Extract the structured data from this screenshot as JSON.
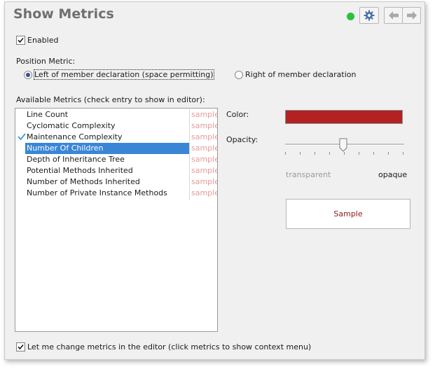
{
  "header": {
    "title": "Show Metrics",
    "status_color": "#2bc13a",
    "buttons": [
      {
        "icon": "gear-icon"
      },
      {
        "icon": "arrow-left-icon"
      },
      {
        "icon": "arrow-right-icon"
      }
    ]
  },
  "enabled": {
    "label": "Enabled",
    "checked": true
  },
  "position": {
    "label": "Position Metric:",
    "options": [
      {
        "label": "Left of member declaration (space permitting)",
        "selected": true
      },
      {
        "label": "Right of member declaration",
        "selected": false
      }
    ]
  },
  "metrics": {
    "label": "Available Metrics (check entry to show in editor):",
    "sample_text": "sample",
    "items": [
      {
        "name": "Line Count",
        "checked": false,
        "selected": false
      },
      {
        "name": "Cyclomatic Complexity",
        "checked": false,
        "selected": false
      },
      {
        "name": "Maintenance Complexity",
        "checked": true,
        "selected": false
      },
      {
        "name": "Number Of Children",
        "checked": false,
        "selected": true
      },
      {
        "name": "Depth of Inheritance Tree",
        "checked": false,
        "selected": false
      },
      {
        "name": "Potential Methods Inherited",
        "checked": false,
        "selected": false
      },
      {
        "name": "Number of Methods Inherited",
        "checked": false,
        "selected": false
      },
      {
        "name": "Number of Private Instance Methods",
        "checked": false,
        "selected": false
      }
    ]
  },
  "appearance": {
    "color_label": "Color:",
    "color_value": "#b22222",
    "opacity_label": "Opacity:",
    "opacity_value": 0.5,
    "min_label": "transparent",
    "max_label": "opaque",
    "preview_text": "Sample"
  },
  "footer": {
    "label": "Let me change metrics in the editor (click metrics to show context menu)",
    "checked": true
  }
}
